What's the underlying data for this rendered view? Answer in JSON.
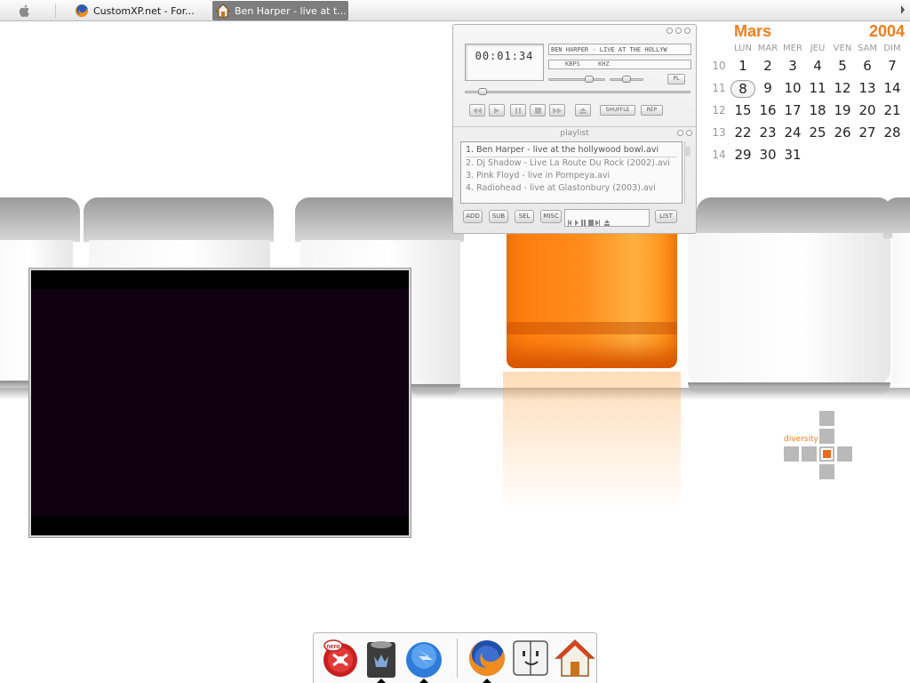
{
  "taskbar": {
    "apple_icon": "apple-icon",
    "tasks": [
      {
        "label": "CustomXP.net - For...",
        "icon": "firefox-icon",
        "active": false
      },
      {
        "label": "Ben Harper - live at t...",
        "icon": "home-icon",
        "active": true
      }
    ]
  },
  "player": {
    "time": "00:01:34",
    "scroll_title": "BEN HARPER - LIVE AT THE HOLLYW",
    "kbps_label": "KBPS",
    "khz_label": "KHZ",
    "pl_button": "PL",
    "shuffle": "SHUFFLE",
    "repeat": "REP",
    "controls": [
      "previous-icon",
      "play-icon",
      "pause-icon",
      "stop-icon",
      "next-icon",
      "eject-icon"
    ],
    "playlist_title": "playlist",
    "playlist": [
      "1. Ben Harper - live at the hollywood bowl.avi",
      "2. Dj Shadow - Live La Route Du Rock (2002).avi",
      "3. Pink Floyd - live in Pompeya.avi",
      "4. Radiohead - live at Glastonbury (2003).avi"
    ],
    "buttons": [
      "ADD",
      "SUB",
      "SEL",
      "MISC",
      "LIST"
    ]
  },
  "calendar": {
    "month": "Mars",
    "year": "2004",
    "headers": [
      "LUN",
      "MAR",
      "MER",
      "JEU",
      "VEN",
      "SAM",
      "DIM"
    ],
    "weeks": [
      {
        "num": "10",
        "days": [
          "1",
          "2",
          "3",
          "4",
          "5",
          "6",
          "7"
        ]
      },
      {
        "num": "11",
        "days": [
          "8",
          "9",
          "10",
          "11",
          "12",
          "13",
          "14"
        ]
      },
      {
        "num": "12",
        "days": [
          "15",
          "16",
          "17",
          "18",
          "19",
          "20",
          "21"
        ]
      },
      {
        "num": "13",
        "days": [
          "22",
          "23",
          "24",
          "25",
          "26",
          "27",
          "28"
        ]
      },
      {
        "num": "14",
        "days": [
          "29",
          "30",
          "31"
        ]
      }
    ],
    "today": "8",
    "accent": "#f07d1a"
  },
  "diversity": {
    "label": "diversity"
  },
  "dock": {
    "items": [
      {
        "name": "nero-icon",
        "running": false
      },
      {
        "name": "trash-icon",
        "running": true
      },
      {
        "name": "thunderbird-icon",
        "running": true
      },
      {
        "name": "firefox-icon",
        "running": true
      },
      {
        "name": "finder-icon",
        "running": false
      },
      {
        "name": "home-icon",
        "running": false
      }
    ]
  }
}
